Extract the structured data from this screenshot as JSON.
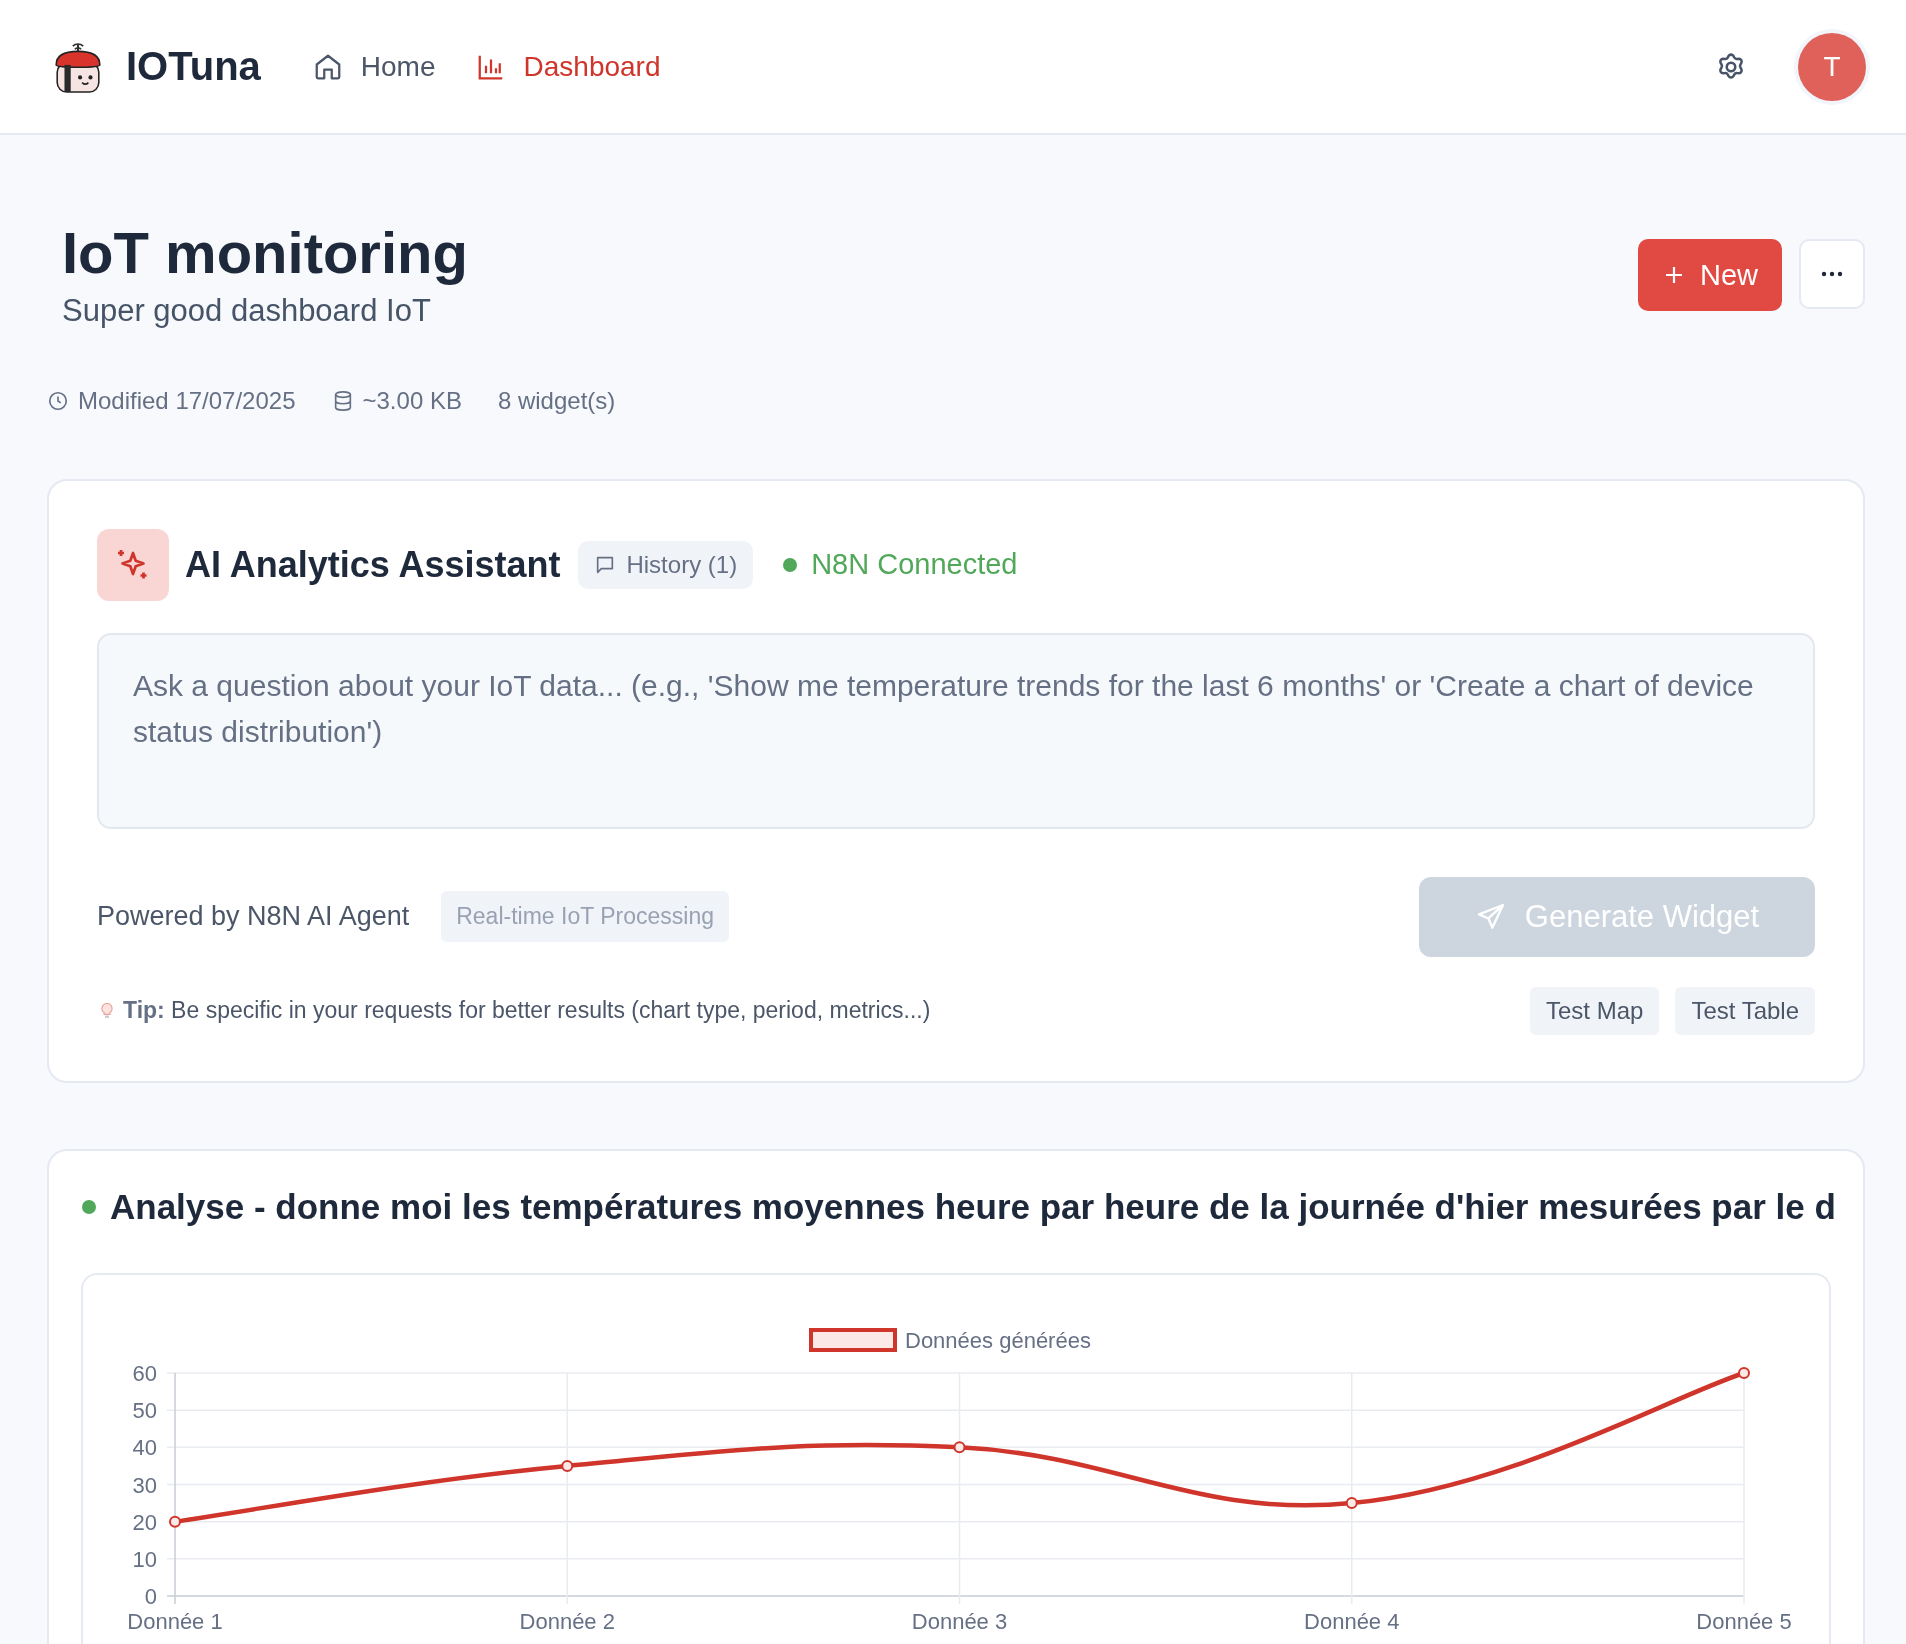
{
  "header": {
    "brand": "IOTuna",
    "nav": [
      {
        "label": "Home",
        "kind": "home",
        "selected": false
      },
      {
        "label": "Dashboard",
        "kind": "chart",
        "selected": true
      }
    ],
    "avatar": "T"
  },
  "page": {
    "title": "IoT monitoring",
    "subtitle": "Super good dashboard IoT",
    "new_button": "New",
    "meta": [
      {
        "kind": "clock",
        "text": "Modified 17/07/2025"
      },
      {
        "kind": "storage",
        "text": "~3.00 KB"
      },
      {
        "kind": "plain",
        "text": "8 widget(s)"
      }
    ]
  },
  "assistant": {
    "title": "AI Analytics Assistant",
    "history_button": "History (1)",
    "status": {
      "label": "N8N Connected",
      "connected": true
    },
    "prompt": {
      "placeholder": "Ask a question about your IoT data... (e.g., 'Show me temperature trends for the last 6 months' or 'Create a chart of device status distribution')"
    },
    "powered_by": "Powered by N8N AI Agent",
    "tag": "Real-time IoT Processing",
    "generate_button": {
      "label": "Generate Widget",
      "disabled": true
    },
    "tip": "**Tip:** Be specific in your requests for better results (chart type, period, metrics...)",
    "test_buttons": [
      "Test Map",
      "Test Table"
    ]
  },
  "widgets": [
    {
      "title": "Analyse - donne moi les températures moyennes heure par heure de la journée d'hier mesurées par le d",
      "color": "#52a85a",
      "chart_data": {
        "type": "line",
        "categories": [
          "Donnée 1",
          "Donnée 2",
          "Donnée 3",
          "Donnée 4",
          "Donnée 5"
        ],
        "series": [
          {
            "name": "Données générées",
            "color": "#d0352b",
            "marker": true,
            "values": [
              20,
              35,
              40,
              25,
              60
            ]
          }
        ],
        "grid": true,
        "ylim": [
          0,
          60
        ],
        "yticks": [
          0,
          10,
          20,
          30,
          40,
          50,
          60
        ]
      }
    }
  ]
}
